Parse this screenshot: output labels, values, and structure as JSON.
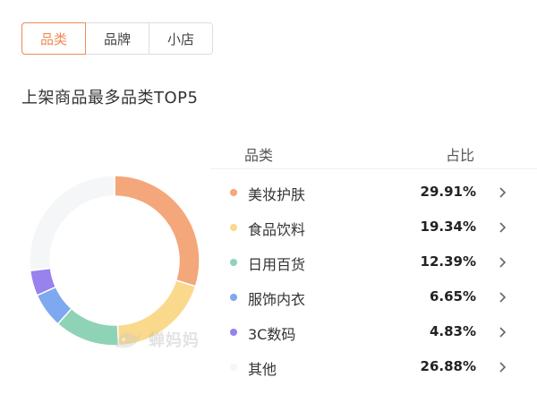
{
  "tabs": [
    {
      "label": "品类",
      "active": true
    },
    {
      "label": "品牌",
      "active": false
    },
    {
      "label": "小店",
      "active": false
    }
  ],
  "section_title": "上架商品最多品类TOP5",
  "table": {
    "header_category": "品类",
    "header_share": "占比"
  },
  "watermark": {
    "text": "蝉妈妈",
    "icon": "chanmama-logo-icon"
  },
  "chart_data": {
    "type": "pie",
    "style": "donut",
    "categories": [
      "美妆护肤",
      "食品饮料",
      "日用百货",
      "服饰内衣",
      "3C数码",
      "其他"
    ],
    "values": [
      29.91,
      19.34,
      12.39,
      6.65,
      4.83,
      26.88
    ],
    "labels": [
      "29.91%",
      "19.34%",
      "12.39%",
      "6.65%",
      "4.83%",
      "26.88%"
    ],
    "colors": [
      "#f4a77a",
      "#fad98c",
      "#8fd3b6",
      "#7ea8ef",
      "#9882ee",
      "#f5f6f8"
    ],
    "legend": "right"
  }
}
